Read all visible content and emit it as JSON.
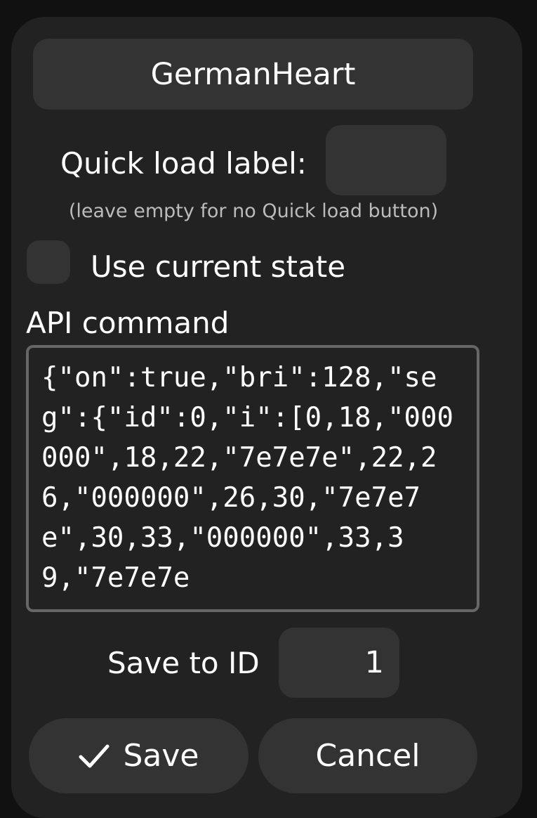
{
  "preset": {
    "name": "GermanHeart"
  },
  "quick_load": {
    "label": "Quick load label:",
    "value": "",
    "hint": "(leave empty for no Quick load button)"
  },
  "use_current_state": {
    "label": "Use current state",
    "checked": false
  },
  "api": {
    "label": "API command",
    "value": "{\"on\":true,\"bri\":128,\"seg\":{\"id\":0,\"i\":[0,18,\"000000\",18,22,\"7e7e7e\",22,26,\"000000\",26,30,\"7e7e7e\",30,33,\"000000\",33,39,\"7e7e7e"
  },
  "save_to_id": {
    "label": "Save to ID",
    "value": "1"
  },
  "buttons": {
    "save": "Save",
    "save_icon": "check-icon",
    "cancel": "Cancel"
  }
}
